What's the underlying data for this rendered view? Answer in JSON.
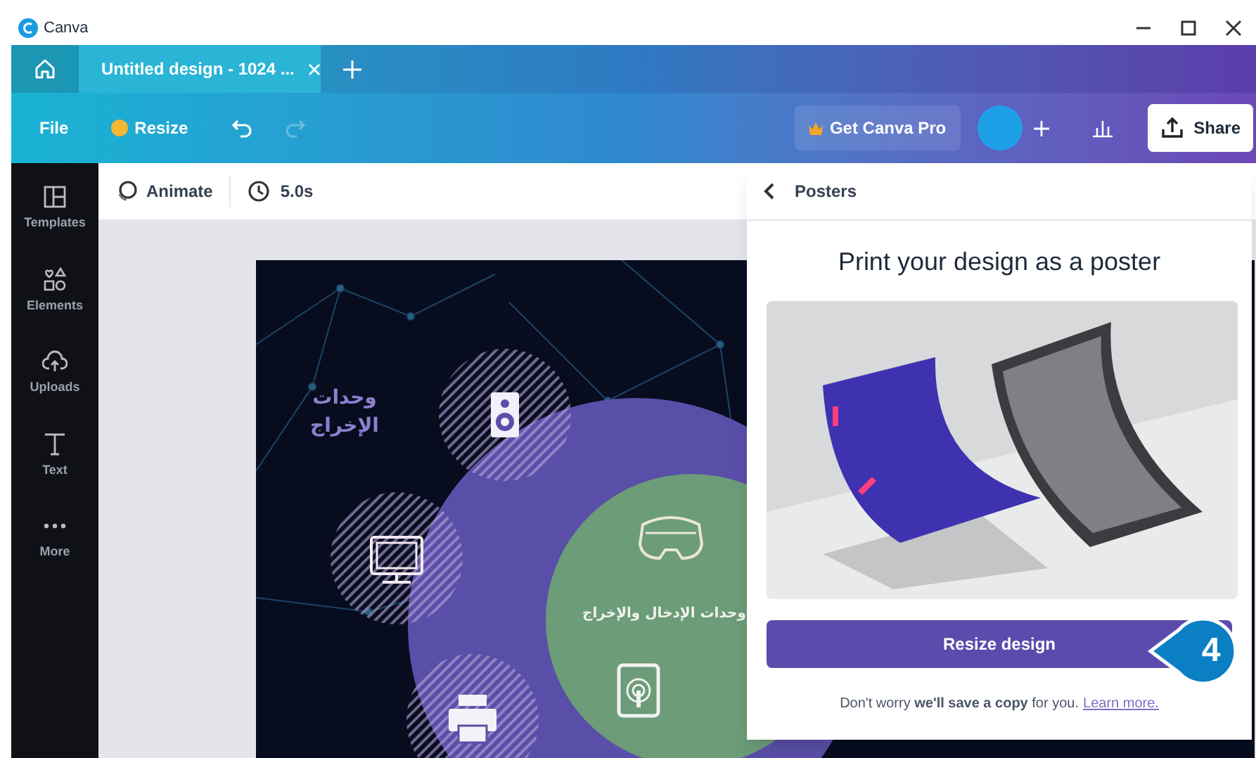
{
  "window": {
    "title": "Canva"
  },
  "tabs": [
    {
      "label": "Untitled design - 1024 ...",
      "selected": true
    }
  ],
  "menu": {
    "file": "File",
    "resize": "Resize"
  },
  "history": [
    {
      "kind": "undo",
      "disabled": false
    },
    {
      "kind": "redo",
      "disabled": true
    }
  ],
  "header_actions": {
    "upgrade": "Get Canva Pro",
    "share": "Share"
  },
  "sidebar": {
    "items": [
      {
        "kind": "templates",
        "label": "Templates"
      },
      {
        "kind": "elements",
        "label": "Elements"
      },
      {
        "kind": "uploads",
        "label": "Uploads"
      },
      {
        "kind": "text",
        "label": "Text"
      },
      {
        "kind": "more",
        "label": "More"
      }
    ]
  },
  "editor_bar": {
    "animate": "Animate",
    "duration": "5.0s"
  },
  "design": {
    "heading": "وحدات الإخراج",
    "center_label": "وحدات الإدخال والإخراج",
    "devices": [
      {
        "kind": "speaker"
      },
      {
        "kind": "monitor"
      },
      {
        "kind": "printer"
      },
      {
        "kind": "headset"
      },
      {
        "kind": "tablet"
      }
    ]
  },
  "panel": {
    "back": "Posters",
    "title": "Print your design as a poster",
    "button": "Resize design",
    "note": "Don't worry **we'll save a copy** for you.",
    "link": "Learn more."
  },
  "callout": {
    "number": "4"
  }
}
